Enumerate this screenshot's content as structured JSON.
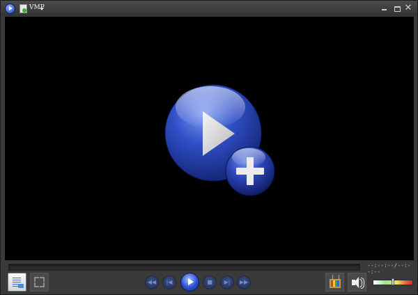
{
  "window": {
    "menu_label": "VMP",
    "close_glyph": "✕"
  },
  "icons": {
    "app": "play-circle-icon",
    "file": "file-icon",
    "open": "open-media-play-plus-icon",
    "playlist": "playlist-icon",
    "fullscreen": "fullscreen-icon",
    "rewind": "rewind-icon",
    "previous": "previous-icon",
    "play": "play-icon",
    "stop": "stop-icon",
    "next": "next-icon",
    "fast_forward": "fast-forward-icon",
    "tv": "tv-icon",
    "volume": "speaker-icon"
  },
  "playback": {
    "time_display": "--:--:--/--:--:--",
    "seek_progress": 0,
    "volume_level": 0.5
  },
  "transport": {
    "rewind_glyph": "◀◀",
    "previous_glyph": "|◀",
    "stop_glyph": "■",
    "next_glyph": "▶|",
    "fast_forward_glyph": "▶▶"
  },
  "colors": {
    "accent_blue": "#2c4fcf",
    "video_background": "#000000",
    "chrome": "#3a3a3a"
  }
}
